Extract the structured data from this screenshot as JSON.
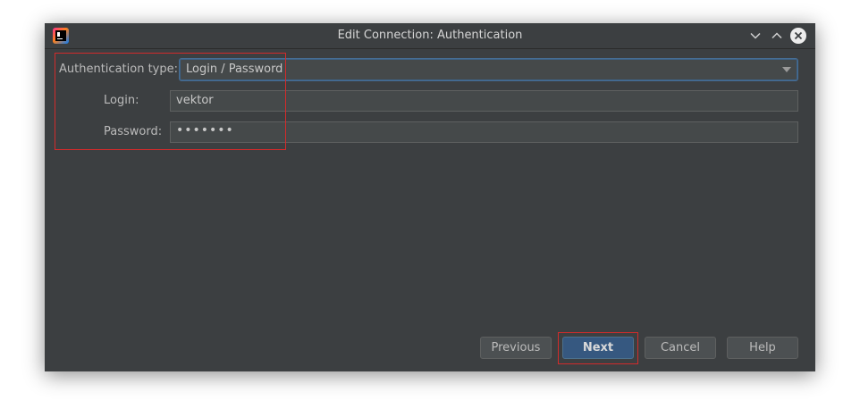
{
  "window": {
    "title": "Edit Connection: Authentication"
  },
  "form": {
    "auth_type_label": "Authentication type:",
    "auth_type_value": "Login / Password",
    "login_label": "Login:",
    "login_value": "vektor",
    "password_label": "Password:",
    "password_value": "•••••••"
  },
  "buttons": {
    "previous": "Previous",
    "next": "Next",
    "cancel": "Cancel",
    "help": "Help"
  },
  "colors": {
    "background": "#3c3f41",
    "field": "#45494a",
    "primary_button": "#365880",
    "highlight": "#d22b2b"
  }
}
